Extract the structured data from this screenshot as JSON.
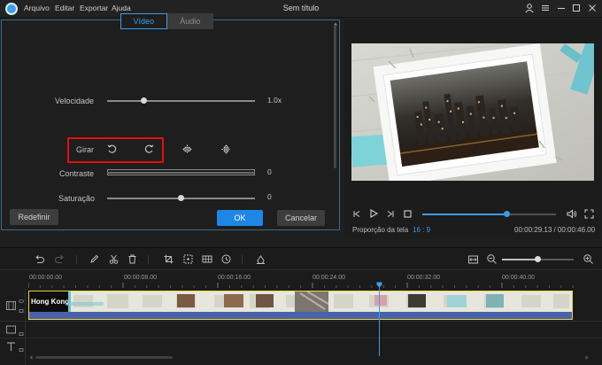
{
  "app": {
    "title": "Sem título",
    "menu": [
      "Arquivo",
      "Editar",
      "Exportar",
      "Ajuda"
    ]
  },
  "edit_panel": {
    "tabs": [
      {
        "label": "Vídeo",
        "active": true
      },
      {
        "label": "Áudio",
        "active": false
      }
    ],
    "speed": {
      "label": "Velocidade",
      "value": "1.0x",
      "level": 0.25
    },
    "rotate": {
      "label": "Girar"
    },
    "contrast": {
      "label": "Contraste",
      "value": "0",
      "level": 0.5
    },
    "saturation": {
      "label": "Saturação",
      "value": "0",
      "level": 0.5
    },
    "buttons": {
      "reset": "Redefinir",
      "ok": "OK",
      "cancel": "Cancelar"
    }
  },
  "player": {
    "aspect_label": "Proporção da tela",
    "aspect_value": "16 : 9",
    "time": "00:00:29.13 / 00:00:46.00",
    "progress": 0.63
  },
  "timeline": {
    "ruler": [
      "00:00:00.00",
      "00:00:08.00",
      "00:00:16.00",
      "00:00:24.00",
      "00:00:32.00",
      "00:00:40.00"
    ],
    "clip_title": "Hong Kong",
    "zoom_level": 0.5
  },
  "colors": {
    "accent": "#1f86e6",
    "highlight": "#e01010",
    "clip_border": "#e8d34a"
  }
}
